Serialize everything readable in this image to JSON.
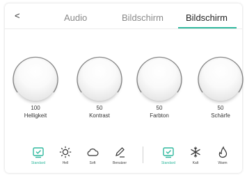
{
  "header": {
    "back_label": "<",
    "tabs": [
      {
        "label": "Audio",
        "active": false
      },
      {
        "label": "Bildschirm",
        "active": false
      },
      {
        "label": "Bildschirm",
        "active": true
      }
    ]
  },
  "knobs": [
    {
      "label": "Helligkeit",
      "value": "100"
    },
    {
      "label": "Kontrast",
      "value": "50"
    },
    {
      "label": "Farbton",
      "value": "50"
    },
    {
      "label": "Schärfe",
      "value": "50"
    }
  ],
  "picture_modes": [
    {
      "label": "Standard",
      "icon": "standard-icon",
      "selected": true
    },
    {
      "label": "Hell",
      "icon": "sun-icon",
      "selected": false
    },
    {
      "label": "Soft",
      "icon": "cloud-icon",
      "selected": false
    },
    {
      "label": "Benutzer",
      "icon": "pencil-icon",
      "selected": false
    }
  ],
  "color_modes": [
    {
      "label": "Standard",
      "icon": "standard-icon",
      "selected": true
    },
    {
      "label": "Kalt",
      "icon": "snowflake-icon",
      "selected": false
    },
    {
      "label": "Warm",
      "icon": "flame-icon",
      "selected": false
    }
  ],
  "colors": {
    "accent": "#2fb89d",
    "text": "#333333",
    "muted": "#8a8a8a"
  }
}
